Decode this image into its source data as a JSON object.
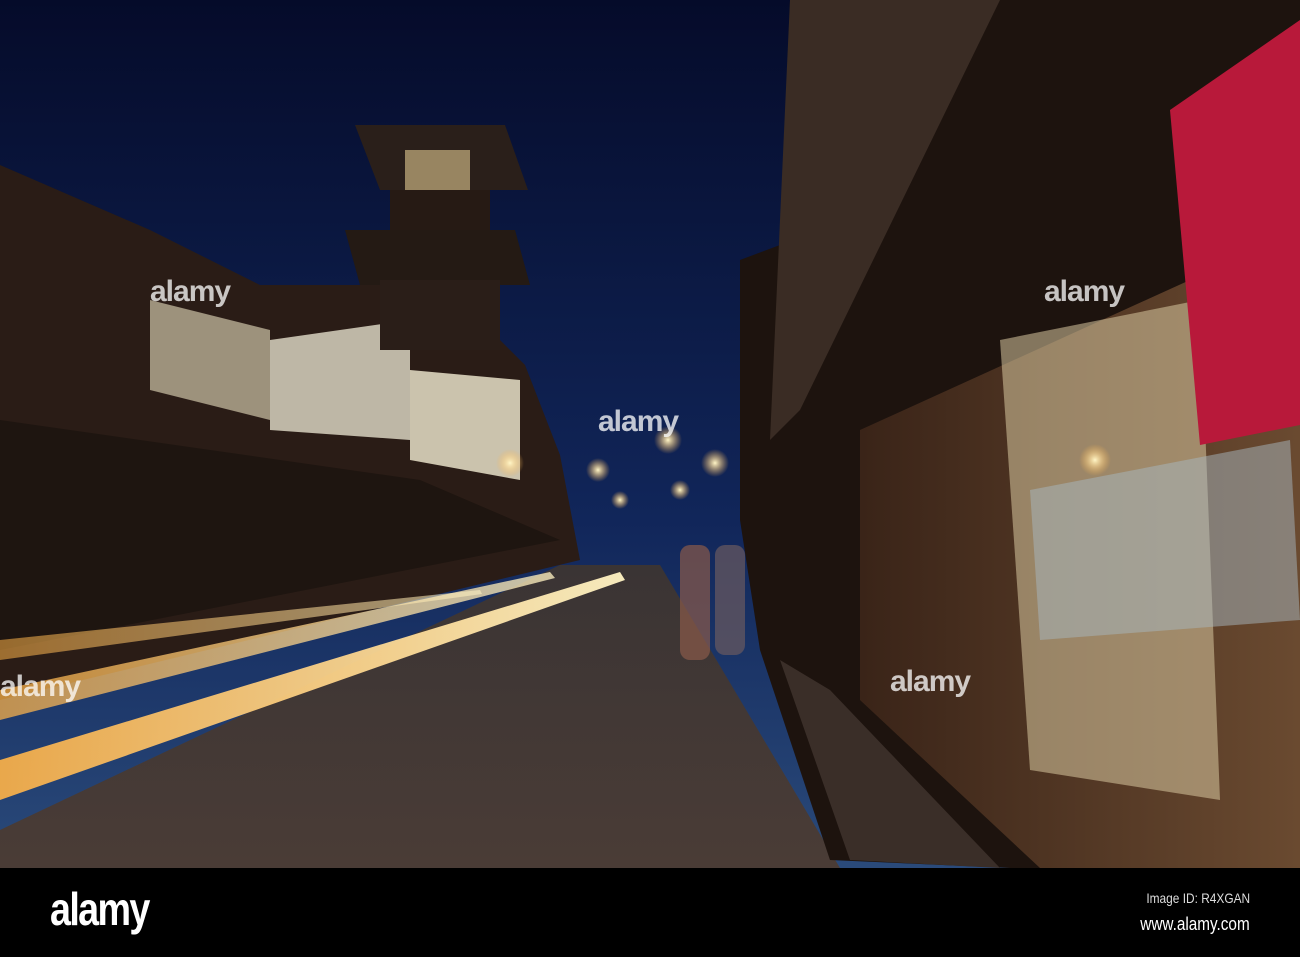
{
  "footer": {
    "logo": "alamy",
    "image_id": "Image ID: R4XGAN",
    "url": "www.alamy.com"
  },
  "watermark": "alamy",
  "colors": {
    "sky_top": "#060d2e",
    "sky_bottom": "#1c3a6e",
    "banner_red": "#b8193a",
    "light_trail": "#ffd27a"
  }
}
